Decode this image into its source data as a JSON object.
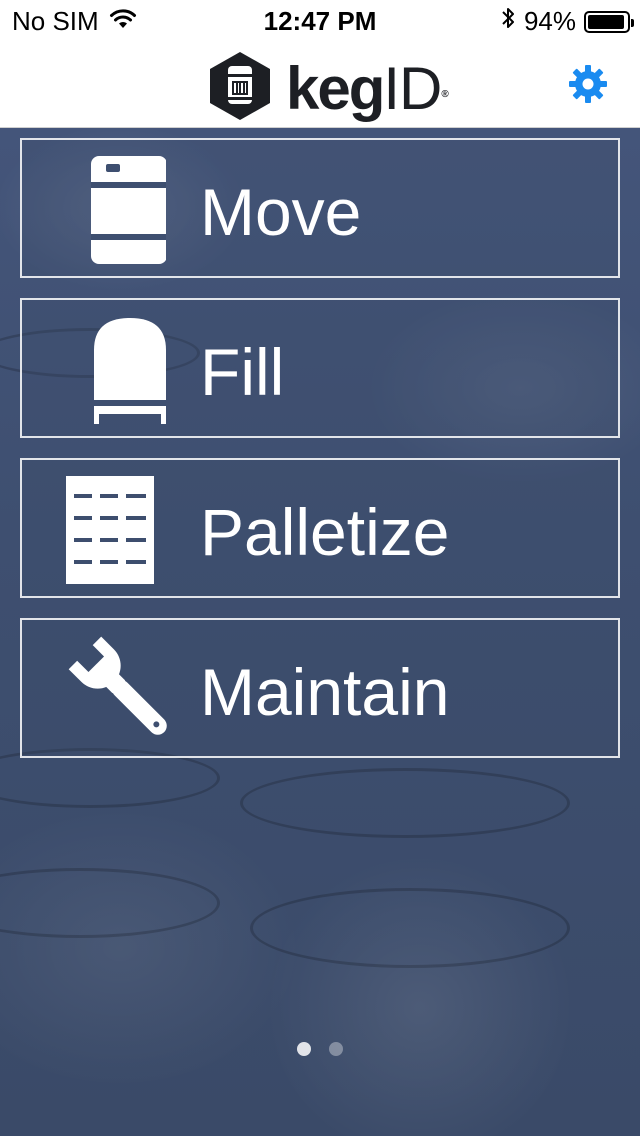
{
  "status_bar": {
    "carrier": "No SIM",
    "time": "12:47 PM",
    "battery_percent": "94%",
    "battery_level": 0.94,
    "icons": [
      "wifi-icon",
      "bluetooth-icon",
      "battery-icon"
    ]
  },
  "header": {
    "logo_text_bold": "keg",
    "logo_text_thin": "ID",
    "logo_mark": "®",
    "settings_icon": "gear-icon",
    "accent_color": "#1a8bf0"
  },
  "menu": {
    "items": [
      {
        "label": "Move",
        "icon": "keg-icon"
      },
      {
        "label": "Fill",
        "icon": "fill-keg-icon"
      },
      {
        "label": "Palletize",
        "icon": "pallet-icon"
      },
      {
        "label": "Maintain",
        "icon": "wrench-icon"
      }
    ]
  },
  "pager": {
    "pages": 2,
    "current": 1
  }
}
